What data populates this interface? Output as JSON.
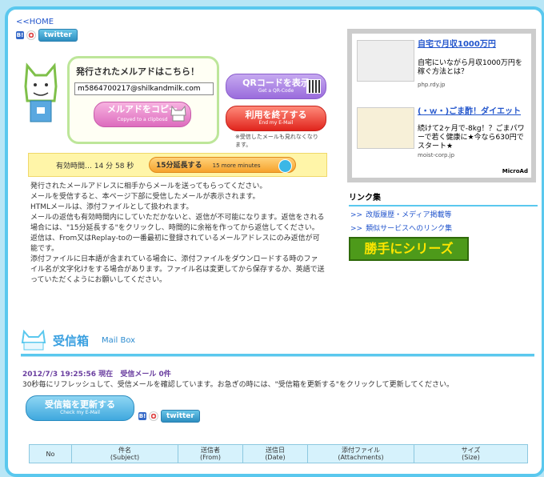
{
  "nav": {
    "home": "<<HOME"
  },
  "social": {
    "hatena": "B!",
    "twitter": "twitter"
  },
  "mail": {
    "title": "発行されたメルアドはこちら！",
    "address": "m5864700217@shilkandmilk.com",
    "copy_label": "メルアドをコピー",
    "copy_sub": "Copyed to a clipbosd",
    "qr_label": "QRコードを表示",
    "qr_sub": "Get a QR-Code",
    "end_label": "利用を終了する",
    "end_sub": "End my E-Mail",
    "note": "※受信したメールも見れなくなります。"
  },
  "timer": {
    "label": "有効時間… 14 分 58 秒",
    "extend_label": "15分延長する",
    "extend_sub": "15 more minutes"
  },
  "description": [
    "発行されたメールアドレスに相手からメールを送ってもらってください。",
    "メールを受信すると、本ページ下部に受信したメールが表示されます。",
    "HTMLメールは、添付ファイルとして扱われます。",
    "メールの返信も有効時間内にしていただかないと、返信が不可能になります。返信をされる場合には、\"15分延長する\"をクリックし、時間的に余裕を作ってから返信してください。",
    "返信は、From又はReplay-toの一番最初に登録されているメールアドレスにのみ返信が可能です。",
    "添付ファイルに日本語が含まれている場合に、添付ファイルをダウンロードする時のファイル名が文字化けをする場合があります。ファイル名は変更してから保存するか、英語で送っていただくようにお願いしてください。"
  ],
  "inbox": {
    "title": "受信箱",
    "title_en": "Mail Box",
    "timestamp": "2012/7/3 19:25:56 現在",
    "count": "受信メール 0件",
    "refresh_note": "30秒毎にリフレッシュして、受信メールを確認しています。お急ぎの時には、\"受信箱を更新する\"をクリックして更新してください。",
    "update_label": "受信箱を更新する",
    "update_sub": "Check my E-Mail"
  },
  "table": {
    "headers": [
      {
        "jp": "No",
        "en": ""
      },
      {
        "jp": "件名",
        "en": "(Subject)"
      },
      {
        "jp": "送信者",
        "en": "(From)"
      },
      {
        "jp": "送信日",
        "en": "(Date)"
      },
      {
        "jp": "添付ファイル",
        "en": "(Attachments)"
      },
      {
        "jp": "サイズ",
        "en": "(Size)"
      }
    ]
  },
  "ads": [
    {
      "title": "自宅で月収1000万円",
      "body": "自宅にいながら月収1000万円を稼ぐ方法とは？",
      "domain": "php.rdy.jp"
    },
    {
      "title": "(・ｗ・)ごま酢！ダイエット",
      "body": "続けて2ヶ月で-8kg！？ごまパワーで若く健康に★今なら630円でスタート★",
      "domain": "moist-corp.jp"
    }
  ],
  "ad_brand": "MicroAd",
  "links": {
    "heading": "リンク集",
    "items": [
      "改版履歴・メディア掲載等",
      "類似サービスへのリンク集"
    ],
    "arrow": ">>",
    "banner": "勝手にシリーズ"
  }
}
